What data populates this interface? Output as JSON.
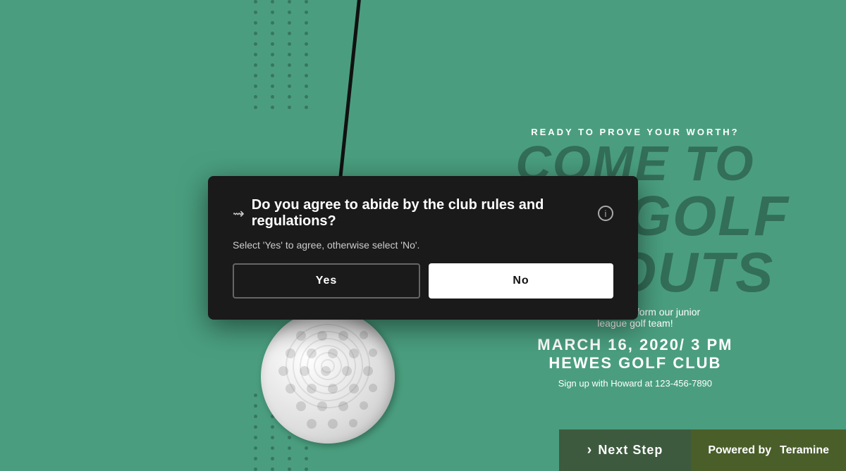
{
  "background": {
    "color": "#4a9e7f"
  },
  "modal": {
    "icon": "≡",
    "title": "Do you agree to abide by the club rules and regulations?",
    "info_icon": "i",
    "subtitle": "Select 'Yes' to agree, otherwise select 'No'.",
    "yes_label": "Yes",
    "no_label": "No"
  },
  "right_panel": {
    "ready_text": "READY TO PROVE YOUR WORTH?",
    "come_to": "COME TO",
    "our_golf": "OUR GOLF",
    "tryouts": "TRYOUTS",
    "subtitle": "We're ready to form our junior\nleague golf team!",
    "date": "MARCH 16, 2020/ 3 PM",
    "location": "HEWES GOLF CLUB",
    "signup": "Sign up with Howard at 123-456-7890"
  },
  "footer": {
    "next_step_label": "Next Step",
    "powered_by_label": "Powered by",
    "brand": "Teramine"
  }
}
